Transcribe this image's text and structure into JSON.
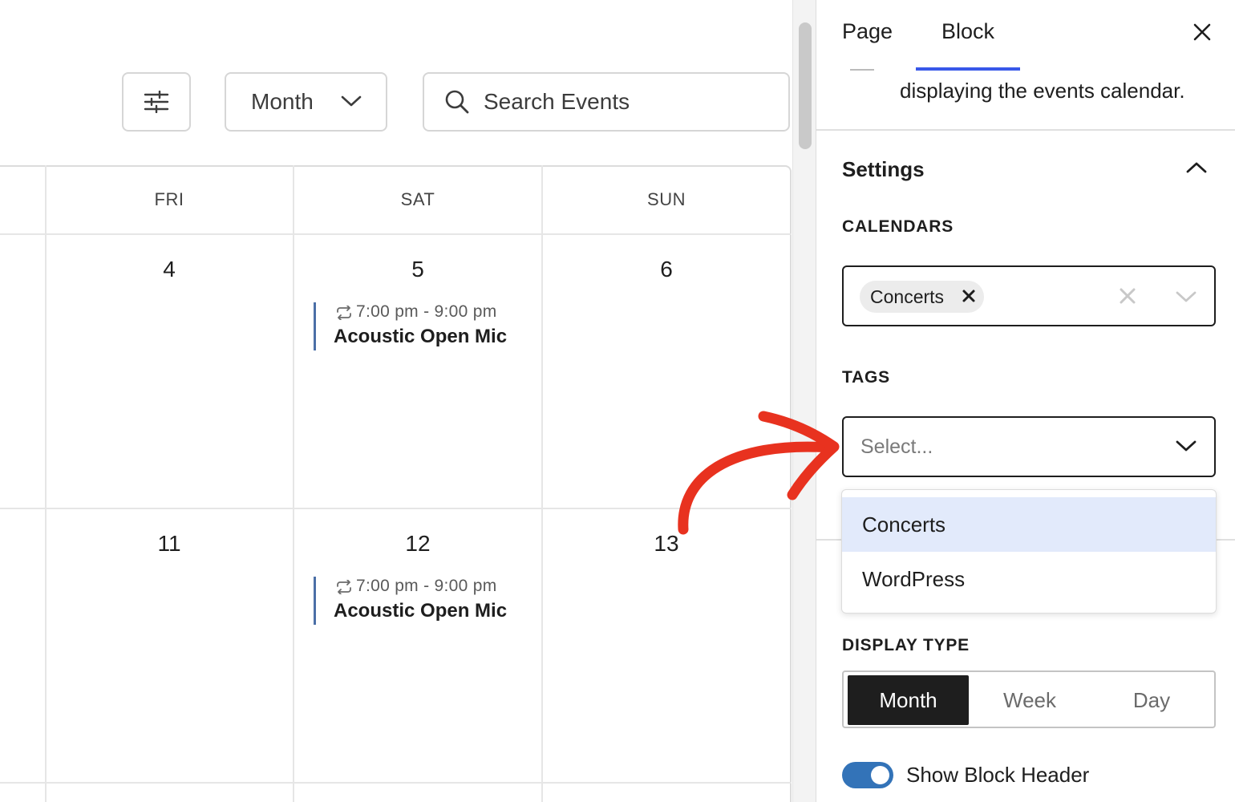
{
  "toolbar": {
    "view_select_value": "Month",
    "search_placeholder": "Search Events"
  },
  "calendar": {
    "day_headers": [
      "FRI",
      "SAT",
      "SUN"
    ],
    "week1_dates": [
      "4",
      "5",
      "6"
    ],
    "week2_dates": [
      "11",
      "12",
      "13"
    ],
    "events": [
      {
        "date": "5",
        "time": "7:00 pm - 9:00 pm",
        "title": "Acoustic Open Mic",
        "recurring": true
      },
      {
        "date": "12",
        "time": "7:00 pm - 9:00 pm",
        "title": "Acoustic Open Mic",
        "recurring": true
      }
    ],
    "event_accent_color": "#4b6fa7"
  },
  "sidebar": {
    "tabs": [
      {
        "label": "Page",
        "active": false
      },
      {
        "label": "Block",
        "active": true
      }
    ],
    "description_fragment": "displaying the events calendar.",
    "settings_title": "Settings",
    "calendars": {
      "label": "CALENDARS",
      "selected": [
        "Concerts"
      ]
    },
    "tags": {
      "label": "TAGS",
      "placeholder": "Select...",
      "options": [
        {
          "label": "Concerts",
          "highlighted": true
        },
        {
          "label": "WordPress",
          "highlighted": false
        }
      ]
    },
    "display_type": {
      "label": "DISPLAY TYPE",
      "options": [
        "Month",
        "Week",
        "Day"
      ],
      "selected": "Month"
    },
    "show_block_header": {
      "label": "Show Block Header",
      "enabled": true
    }
  },
  "colors": {
    "tab_active_underline": "#3858e9",
    "toggle_on": "#3373b8",
    "annotation_arrow": "#e8321f",
    "option_highlight": "#e2eafb"
  },
  "icons": [
    "filter-sliders-icon",
    "chevron-down-icon",
    "search-icon",
    "repeat-icon",
    "close-icon",
    "chevron-up-icon"
  ]
}
